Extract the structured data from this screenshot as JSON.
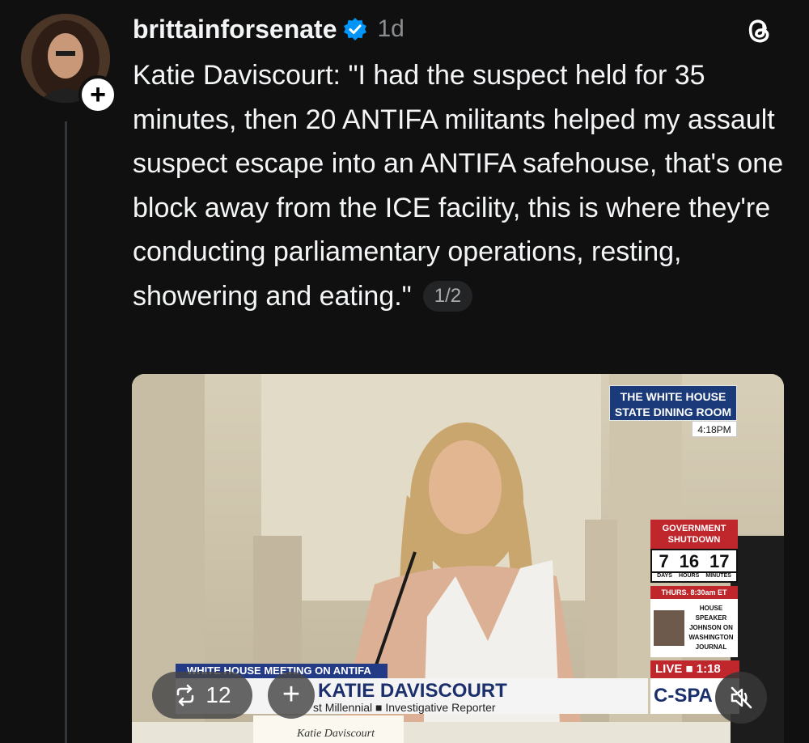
{
  "post": {
    "username": "brittainforsenate",
    "time": "1d",
    "text": "Katie Daviscourt: \"I had the suspect held for 35 minutes, then 20 ANTIFA militants helped my assault suspect escape into an ANTIFA safehouse, that's one block away from the ICE facility, this is where they're conducting parliamentary operations, resting, showering and eating.\"",
    "page_indicator": "1/2",
    "verified_icon": "verified-badge-icon",
    "app_icon": "threads-logo-icon"
  },
  "video": {
    "location_line1": "THE WHITE HOUSE",
    "location_line2": "STATE DINING ROOM",
    "location_time": "4:18PM",
    "shutdown_title": "GOVERNMENT SHUTDOWN",
    "shutdown_days": "7",
    "shutdown_hours": "16",
    "shutdown_minutes": "17",
    "shutdown_days_label": "DAYS",
    "shutdown_hours_label": "HOURS",
    "shutdown_minutes_label": "MINUTES",
    "promo_time": "THURS. 8:30am ET",
    "promo_text": "HOUSE SPEAKER JOHNSON ON WASHINGTON JOURNAL",
    "live_label": "LIVE ■  1:18",
    "network": "C-SPA",
    "chyron_top": "WHITE HOUSE MEETING ON ANTIFA",
    "chyron_name": "KATIE DAVISCOURT",
    "chyron_sub": "st Millennial  ■  Investigative Reporter",
    "nameplate": "Katie Daviscourt",
    "repost_count": "12"
  },
  "colors": {
    "background": "#101010",
    "text": "#f3f5f7",
    "muted": "#8a8d91",
    "verified": "#0095f6",
    "cspan_red": "#c0272d",
    "cspan_blue": "#233a86"
  }
}
